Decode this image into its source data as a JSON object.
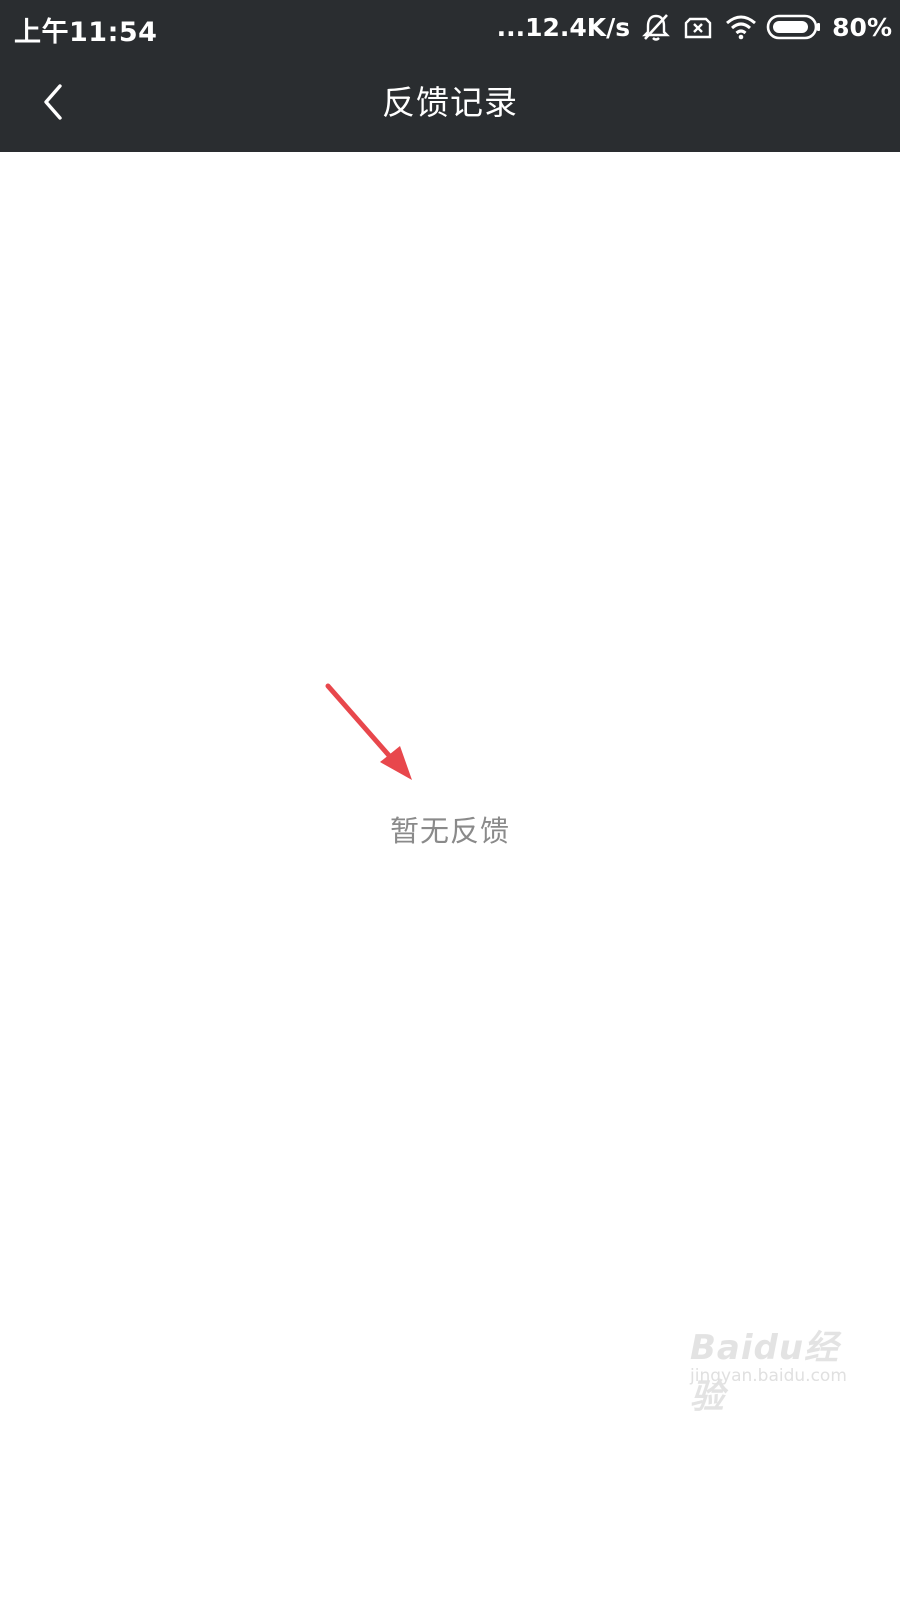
{
  "status_bar": {
    "time": "上午11:54",
    "speed": "...12.4K/s",
    "battery": "80%"
  },
  "header": {
    "title": "反馈记录"
  },
  "content": {
    "empty_message": "暂无反馈"
  },
  "watermark": {
    "logo": "Baidu经验",
    "url": "jingyan.baidu.com"
  },
  "colors": {
    "bar_background": "#2a2d30",
    "empty_text": "#8a8a8a",
    "annotation_arrow": "#e8474c"
  },
  "icons": {
    "back": "chevron-left-icon",
    "mute": "bell-off-icon",
    "sim": "no-sim-icon",
    "wifi": "wifi-icon",
    "battery": "battery-icon"
  }
}
